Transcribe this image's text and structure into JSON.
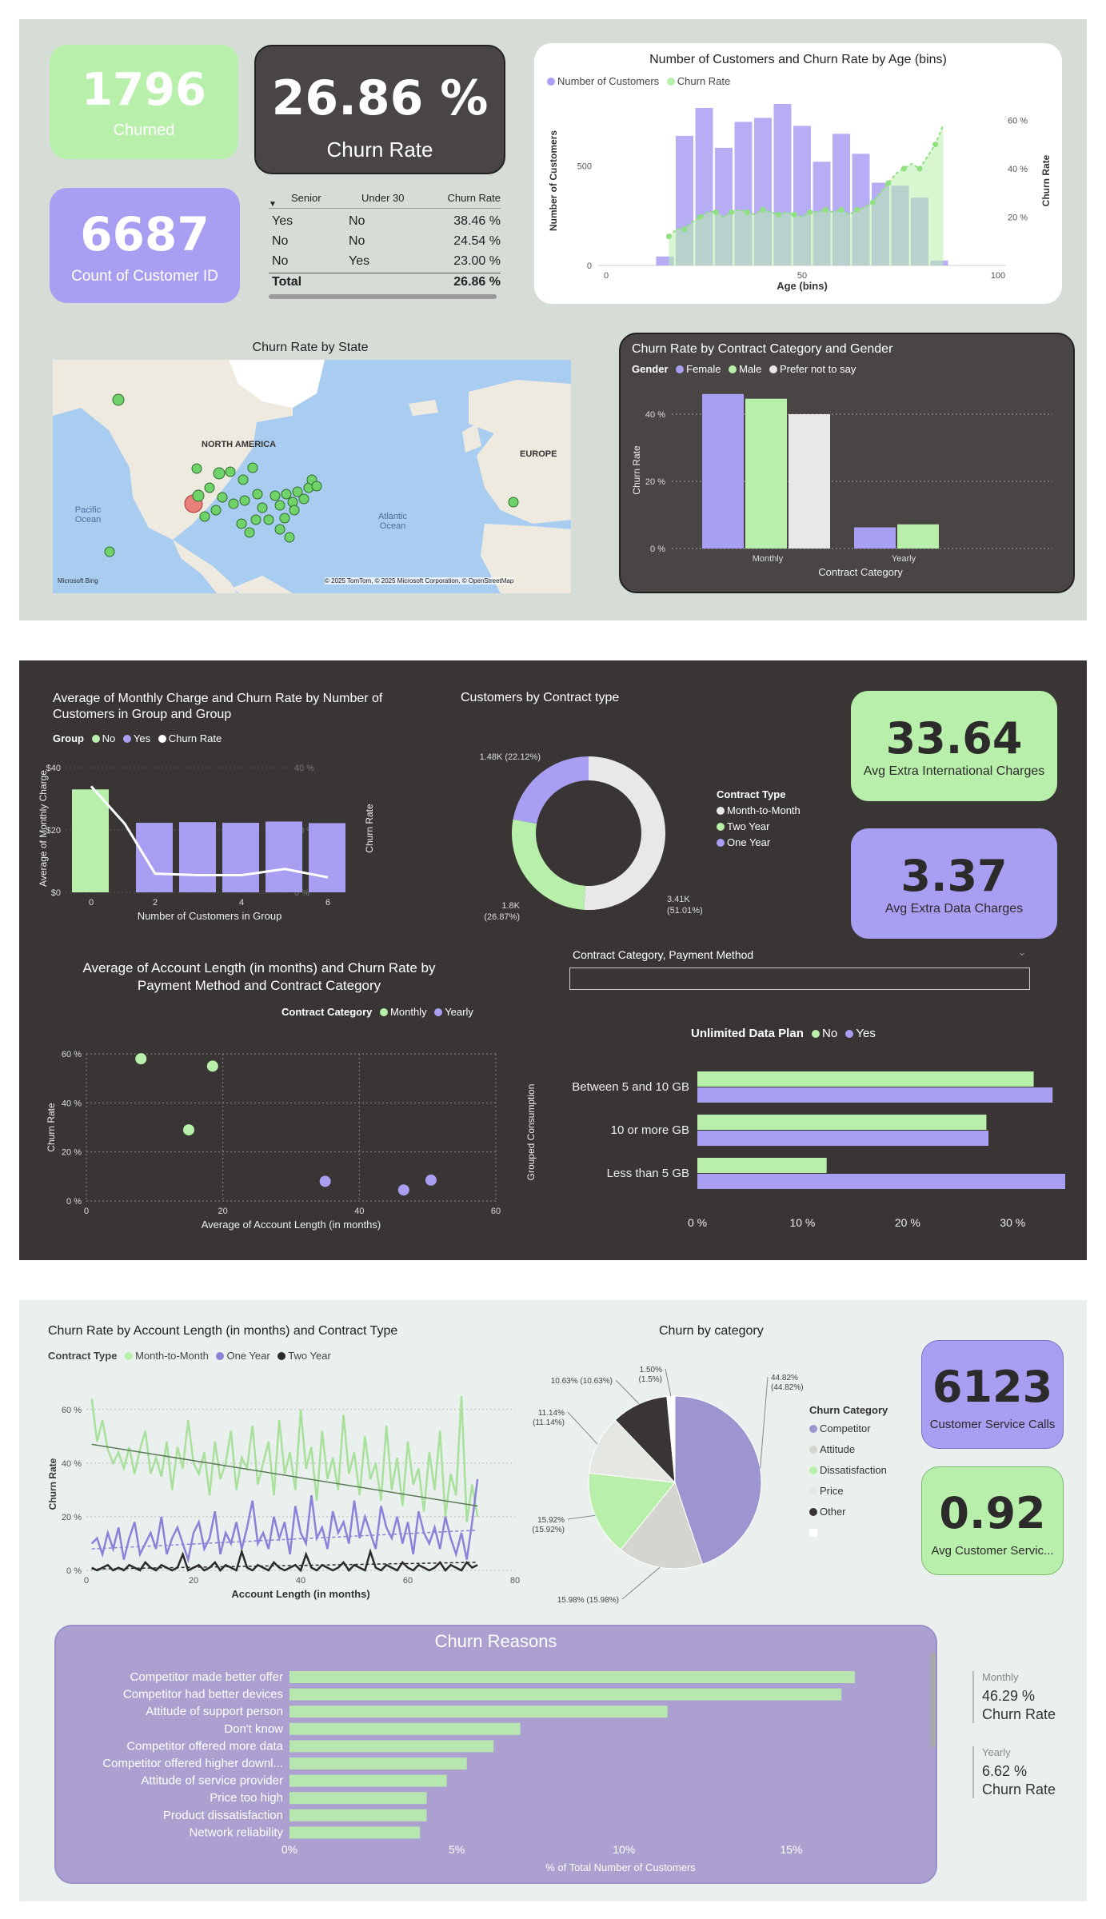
{
  "kpis": {
    "churned": {
      "value": "1796",
      "label": "Churned"
    },
    "churn_rate": {
      "value": "26.86 %",
      "label": "Churn Rate"
    },
    "customers": {
      "value": "6687",
      "label": "Count of Customer ID"
    },
    "extra_intl": {
      "value": "33.64",
      "label": "Avg Extra International Charges"
    },
    "extra_data": {
      "value": "3.37",
      "label": "Avg Extra Data Charges"
    },
    "service_calls": {
      "value": "6123",
      "label": "Customer Service Calls"
    },
    "avg_service": {
      "value": "0.92",
      "label": "Avg Customer Servic..."
    }
  },
  "senior_table": {
    "headers": [
      "Senior",
      "Under 30",
      "Churn Rate"
    ],
    "rows": [
      [
        "Yes",
        "No",
        "38.46 %"
      ],
      [
        "No",
        "No",
        "24.54 %"
      ],
      [
        "No",
        "Yes",
        "23.00 %"
      ]
    ],
    "total": [
      "Total",
      "26.86 %"
    ]
  },
  "map": {
    "title": "Churn Rate by State",
    "labels": [
      "NORTH AMERICA",
      "EUROPE",
      "Pacific Ocean",
      "Atlantic Ocean"
    ],
    "attribution": "© 2025 TomTom, © 2025 Microsoft Corporation, © OpenStreetMap",
    "brand": "Microsoft Bing",
    "colors": {
      "normal": "#6fd36a",
      "high": "#e8807a"
    }
  },
  "colors": {
    "green": "#b8f0ab",
    "purple": "#a99ff2",
    "dark": "#3a3535",
    "gray": "#e8e8e8"
  },
  "chart_data": [
    {
      "id": "age",
      "type": "bar",
      "title": "Number of Customers and Churn Rate by Age (bins)",
      "xlabel": "Age (bins)",
      "ylabel": "Number of Customers",
      "y2label": "Churn Rate",
      "legend": [
        "Number of Customers",
        "Churn Rate"
      ],
      "x": [
        15,
        20,
        25,
        30,
        35,
        40,
        45,
        50,
        55,
        60,
        65,
        70,
        75,
        80,
        85
      ],
      "xticks": [
        0,
        50,
        100
      ],
      "yticks": [
        0,
        500
      ],
      "y2ticks": [
        "20 %",
        "40 %",
        "60 %"
      ],
      "xlim": [
        0,
        100
      ],
      "ylim": [
        0,
        850
      ],
      "y2lim": [
        0,
        70
      ],
      "bars": [
        45,
        650,
        790,
        590,
        720,
        740,
        810,
        700,
        520,
        660,
        560,
        415,
        400,
        340,
        25
      ],
      "rate": [
        [
          16,
          12
        ],
        [
          18,
          15
        ],
        [
          20,
          15
        ],
        [
          22,
          18
        ],
        [
          24,
          20
        ],
        [
          26,
          22
        ],
        [
          28,
          22
        ],
        [
          30,
          20
        ],
        [
          32,
          22
        ],
        [
          34,
          23
        ],
        [
          36,
          22
        ],
        [
          38,
          21
        ],
        [
          40,
          23
        ],
        [
          42,
          22
        ],
        [
          44,
          21
        ],
        [
          46,
          22
        ],
        [
          48,
          21
        ],
        [
          50,
          20
        ],
        [
          52,
          22
        ],
        [
          54,
          22
        ],
        [
          56,
          23
        ],
        [
          58,
          22
        ],
        [
          60,
          23
        ],
        [
          62,
          21
        ],
        [
          64,
          23
        ],
        [
          66,
          24
        ],
        [
          68,
          26
        ],
        [
          70,
          30
        ],
        [
          72,
          34
        ],
        [
          74,
          38
        ],
        [
          76,
          40
        ],
        [
          78,
          42
        ],
        [
          80,
          40
        ],
        [
          82,
          45
        ],
        [
          84,
          50
        ],
        [
          86,
          58
        ]
      ]
    },
    {
      "id": "contract_gender",
      "type": "bar",
      "title": "Churn Rate by Contract Category and Gender",
      "legend_title": "Gender",
      "xlabel": "Contract Category",
      "ylabel": "Churn Rate",
      "categories": [
        "Monthly",
        "Yearly"
      ],
      "yticks": [
        "0 %",
        "20 %",
        "40 %"
      ],
      "ylim": [
        0,
        50
      ],
      "series": [
        {
          "name": "Female",
          "values": [
            46,
            6.3
          ]
        },
        {
          "name": "Male",
          "values": [
            44.6,
            7.2
          ]
        },
        {
          "name": "Prefer not to say",
          "values": [
            40,
            0
          ]
        }
      ]
    },
    {
      "id": "monthly_charge",
      "type": "bar",
      "title": "Average of Monthly Charge and Churn Rate by Number of Customers in Group and Group",
      "legend_title": "Group",
      "legend": [
        "No",
        "Yes",
        "Churn Rate"
      ],
      "xlabel": "Number of Customers in Group",
      "ylabel": "Average of Monthly Charge",
      "y2label": "Churn Rate",
      "x": [
        0,
        2,
        3,
        4,
        5,
        6
      ],
      "xticks": [
        0,
        2,
        4,
        6
      ],
      "yticks": [
        "$0",
        "$20",
        "$40"
      ],
      "y2ticks": [
        "0 %",
        "20 %",
        "40 %"
      ],
      "ylim": [
        0,
        40
      ],
      "values": [
        33,
        22.3,
        22.5,
        22.3,
        22.7,
        22.2
      ],
      "groups": [
        "No",
        "Yes",
        "Yes",
        "Yes",
        "Yes",
        "Yes"
      ],
      "rate_x": [
        0,
        1,
        2,
        3,
        4,
        5,
        6
      ],
      "rate": [
        34,
        22,
        6,
        5.5,
        5.5,
        7.5,
        4.8
      ]
    },
    {
      "id": "contract_type",
      "type": "pie",
      "title": "Customers by Contract type",
      "legend_title": "Contract Type",
      "series": [
        {
          "name": "Month-to-Month",
          "value": 3.41,
          "label": "3.41K",
          "pct": "(51.01%)"
        },
        {
          "name": "Two Year",
          "value": 1.8,
          "label": "1.8K",
          "pct": "(26.87%)"
        },
        {
          "name": "One Year",
          "value": 1.48,
          "label": "1.48K (22.12%)",
          "pct": ""
        }
      ]
    },
    {
      "id": "account_length_scatter",
      "type": "scatter",
      "title": "Average of Account Length (in months) and Churn Rate by Payment Method and Contract Category",
      "legend_title": "Contract Category",
      "legend": [
        "Monthly",
        "Yearly"
      ],
      "xlabel": "Average of Account Length (in months)",
      "ylabel": "Churn Rate",
      "xticks": [
        0,
        20,
        40,
        60
      ],
      "yticks": [
        "0 %",
        "20 %",
        "40 %",
        "60 %"
      ],
      "xlim": [
        0,
        60
      ],
      "ylim": [
        0,
        60
      ],
      "points": [
        {
          "x": 8,
          "y": 58,
          "series": "Monthly"
        },
        {
          "x": 18.5,
          "y": 55,
          "series": "Monthly"
        },
        {
          "x": 15,
          "y": 29,
          "series": "Monthly"
        },
        {
          "x": 35,
          "y": 8,
          "series": "Yearly"
        },
        {
          "x": 46.5,
          "y": 4.5,
          "series": "Yearly"
        },
        {
          "x": 50.5,
          "y": 8.5,
          "series": "Yearly"
        }
      ]
    },
    {
      "id": "consumption",
      "type": "bar",
      "title": "Unlimited Data Plan",
      "legend": [
        "No",
        "Yes"
      ],
      "ylabel": "Grouped Consumption",
      "categories": [
        "Between 5 and 10 GB",
        "10 or more GB",
        "Less than 5 GB"
      ],
      "xticks": [
        "0 %",
        "10 %",
        "20 %",
        "30 %"
      ],
      "xlim": [
        0,
        35
      ],
      "series": [
        {
          "name": "No",
          "values": [
            32,
            27.5,
            12.3
          ]
        },
        {
          "name": "Yes",
          "values": [
            33.8,
            27.7,
            35
          ]
        }
      ]
    },
    {
      "id": "account_length_line",
      "type": "line",
      "title": "Churn Rate by Account Length (in months) and Contract Type",
      "legend_title": "Contract Type",
      "legend": [
        "Month-to-Month",
        "One Year",
        "Two Year"
      ],
      "xlabel": "Account Length (in months)",
      "ylabel": "Churn Rate",
      "xticks": [
        0,
        20,
        40,
        60,
        80
      ],
      "yticks": [
        "0 %",
        "20 %",
        "40 %",
        "60 %"
      ],
      "xlim": [
        0,
        80
      ],
      "ylim": [
        0,
        65
      ],
      "series": [
        {
          "name": "Month-to-Month",
          "values": [
            64,
            48,
            56,
            45,
            40,
            44,
            38,
            46,
            36,
            45,
            52,
            36,
            42,
            35,
            48,
            30,
            46,
            38,
            56,
            40,
            36,
            44,
            28,
            48,
            34,
            40,
            52,
            30,
            42,
            38,
            54,
            32,
            40,
            48,
            28,
            56,
            36,
            44,
            30,
            60,
            38,
            46,
            26,
            52,
            34,
            42,
            30,
            58,
            36,
            44,
            28,
            50,
            34,
            40,
            26,
            54,
            30,
            42,
            24,
            48,
            32,
            38,
            22,
            44,
            30,
            52,
            20,
            36,
            28,
            65,
            18,
            32,
            20
          ]
        },
        {
          "name": "One Year",
          "values": [
            10,
            12,
            6,
            14,
            8,
            16,
            4,
            12,
            18,
            6,
            10,
            14,
            8,
            20,
            6,
            12,
            16,
            10,
            4,
            14,
            18,
            8,
            12,
            22,
            6,
            14,
            10,
            18,
            8,
            16,
            26,
            10,
            14,
            8,
            20,
            12,
            18,
            6,
            24,
            14,
            10,
            28,
            12,
            16,
            8,
            22,
            14,
            18,
            10,
            26,
            12,
            20,
            14,
            8,
            24,
            16,
            12,
            20,
            10,
            18,
            6,
            22,
            14,
            10,
            16,
            8,
            20,
            12,
            6,
            14,
            4,
            18,
            34
          ]
        },
        {
          "name": "Two Year",
          "values": [
            1,
            0,
            1,
            2,
            0,
            1,
            0,
            2,
            1,
            0,
            3,
            1,
            0,
            2,
            1,
            0,
            1,
            6,
            0,
            1,
            2,
            0,
            1,
            3,
            0,
            2,
            1,
            0,
            7,
            1,
            0,
            2,
            1,
            0,
            3,
            1,
            0,
            1,
            2,
            0,
            6,
            1,
            0,
            2,
            1,
            0,
            1,
            3,
            0,
            2,
            1,
            0,
            7,
            1,
            0,
            2,
            1,
            0,
            3,
            1,
            0,
            2,
            1,
            0,
            1,
            3,
            0,
            2,
            1,
            0,
            3,
            1,
            2
          ]
        }
      ],
      "trends": [
        {
          "name": "Month-to-Month",
          "from": 47,
          "to": 24
        },
        {
          "name": "One Year",
          "from": 8,
          "to": 15
        },
        {
          "name": "Two Year",
          "from": 0.5,
          "to": 3
        }
      ]
    },
    {
      "id": "churn_category",
      "type": "pie",
      "title": "Churn by category",
      "legend_title": "Churn Category",
      "series": [
        {
          "name": "Competitor",
          "value": 44.82,
          "label": "44.82%",
          "pct": "(44.82%)"
        },
        {
          "name": "Attitude",
          "value": 15.98,
          "label": "15.98% (15.98%)",
          "pct": ""
        },
        {
          "name": "Dissatisfaction",
          "value": 15.92,
          "label": "15.92%",
          "pct": "(15.92%)"
        },
        {
          "name": "Price",
          "value": 11.14,
          "label": "11.14%",
          "pct": "(11.14%)"
        },
        {
          "name": "Other",
          "value": 10.63,
          "label": "10.63% (10.63%)",
          "pct": ""
        },
        {
          "name": "",
          "value": 1.5,
          "label": "1.50%",
          "pct": "(1.5%)"
        }
      ]
    },
    {
      "id": "churn_reasons",
      "type": "bar",
      "title": "Churn Reasons",
      "xlabel": "% of Total Number of Customers",
      "xticks": [
        "0%",
        "5%",
        "10%",
        "15%"
      ],
      "xlim": [
        0,
        17.5
      ],
      "categories": [
        "Competitor made better offer",
        "Competitor had better devices",
        "Attitude of support person",
        "Don't know",
        "Competitor offered more data",
        "Competitor offered higher downl...",
        "Attitude of service provider",
        "Price too high",
        "Product dissatisfaction",
        "Network reliability"
      ],
      "values": [
        16.9,
        16.5,
        11.3,
        6.9,
        6.1,
        5.3,
        4.7,
        4.1,
        4.1,
        3.9
      ]
    }
  ],
  "contract_summary": {
    "monthly": {
      "label": "Monthly",
      "rate": "46.29 %",
      "caption": "Churn Rate"
    },
    "yearly": {
      "label": "Yearly",
      "rate": "6.62 %",
      "caption": "Churn Rate"
    }
  },
  "slicer": {
    "label": "Contract Category, Payment Method"
  }
}
